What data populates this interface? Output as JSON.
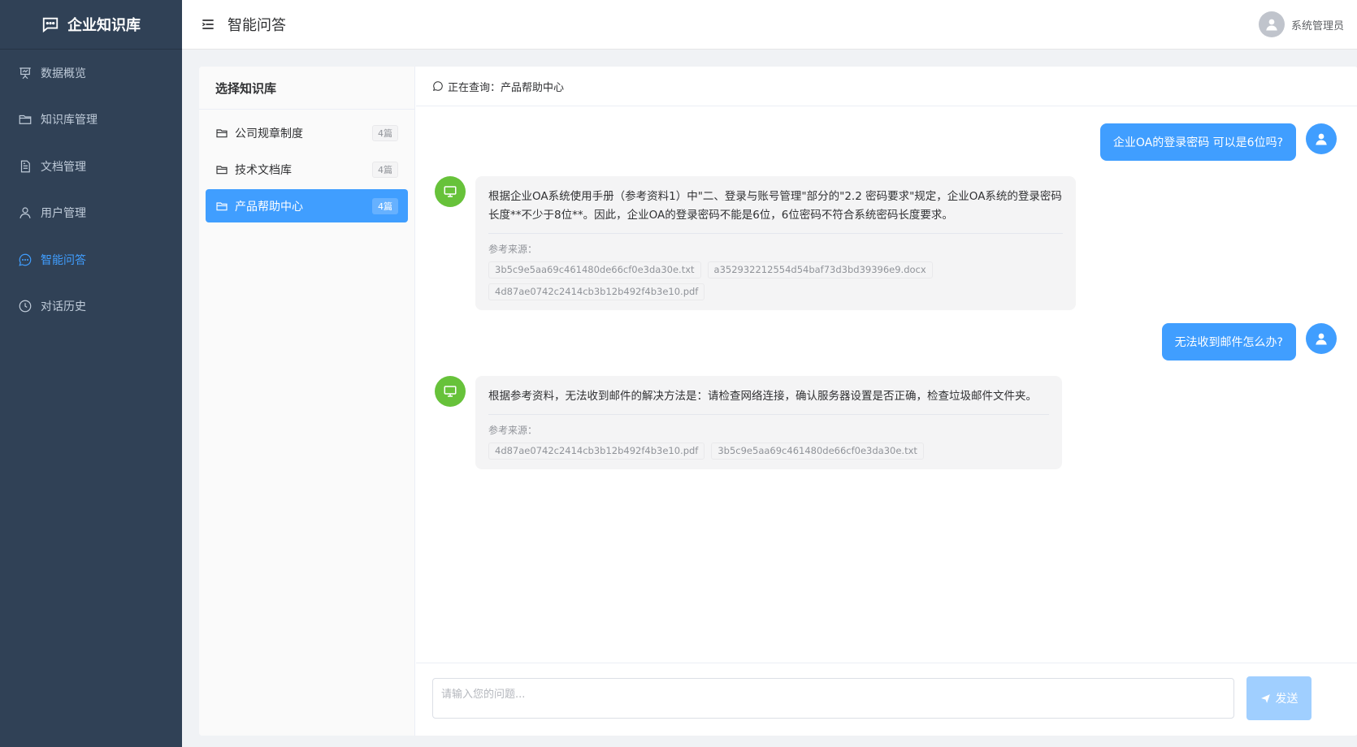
{
  "app": {
    "brand": "企业知识库"
  },
  "sidebar": {
    "items": [
      {
        "label": "数据概览",
        "icon": "presentation-icon"
      },
      {
        "label": "知识库管理",
        "icon": "folder-icon"
      },
      {
        "label": "文档管理",
        "icon": "document-icon"
      },
      {
        "label": "用户管理",
        "icon": "user-icon"
      },
      {
        "label": "智能问答",
        "icon": "chat-icon",
        "active": true
      },
      {
        "label": "对话历史",
        "icon": "clock-icon"
      }
    ]
  },
  "header": {
    "title": "智能问答",
    "user_name": "系统管理员"
  },
  "kb_panel": {
    "title": "选择知识库",
    "items": [
      {
        "name": "公司规章制度",
        "count": "4篇"
      },
      {
        "name": "技术文档库",
        "count": "4篇"
      },
      {
        "name": "产品帮助中心",
        "count": "4篇",
        "active": true
      }
    ]
  },
  "chat": {
    "status": "正在查询：产品帮助中心",
    "source_label": "参考来源：",
    "messages": [
      {
        "role": "user",
        "text": "企业OA的登录密码 可以是6位吗?"
      },
      {
        "role": "bot",
        "text": "根据企业OA系统使用手册（参考资料1）中\"二、登录与账号管理\"部分的\"2.2 密码要求\"规定，企业OA系统的登录密码长度**不少于8位**。因此，企业OA的登录密码不能是6位，6位密码不符合系统密码长度要求。",
        "sources": [
          "3b5c9e5aa69c461480de66cf0e3da30e.txt",
          "a352932212554d54baf73d3bd39396e9.docx",
          "4d87ae0742c2414cb3b12b492f4b3e10.pdf"
        ]
      },
      {
        "role": "user",
        "text": "无法收到邮件怎么办?"
      },
      {
        "role": "bot",
        "text": "根据参考资料，无法收到邮件的解决方法是：请检查网络连接，确认服务器设置是否正确，检查垃圾邮件文件夹。",
        "sources": [
          "4d87ae0742c2414cb3b12b492f4b3e10.pdf",
          "3b5c9e5aa69c461480de66cf0e3da30e.txt"
        ]
      }
    ]
  },
  "input": {
    "placeholder": "请输入您的问题...",
    "value": "",
    "send_label": "发送"
  },
  "colors": {
    "sidebar_bg": "#304156",
    "primary": "#409eff",
    "bot_avatar": "#67c23a",
    "send_disabled": "#a0cfff"
  }
}
